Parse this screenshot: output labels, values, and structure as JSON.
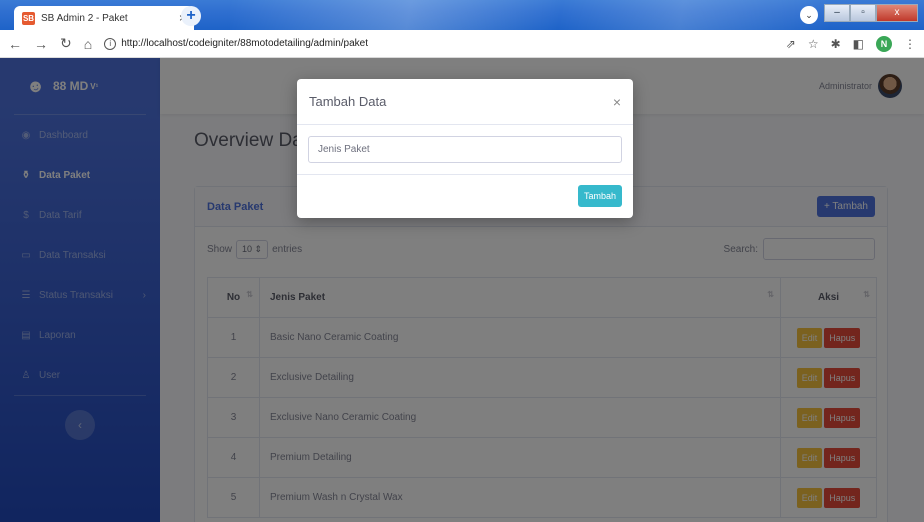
{
  "browser": {
    "tab_title": "SB Admin 2 - Paket",
    "tab_close": "×",
    "new_tab": "+",
    "url": "http://localhost/codeigniter/88motodetailing/admin/paket",
    "avatar_letter": "N",
    "window_controls": [
      "–",
      "▫",
      "x"
    ]
  },
  "sidebar": {
    "brand": "88 MD",
    "brand_sup": "V¹",
    "items": [
      {
        "label": "Dashboard",
        "icon": "tachometer-icon",
        "glyph": "◉"
      },
      {
        "label": "Data Paket",
        "icon": "bottle-icon",
        "glyph": "⚱"
      },
      {
        "label": "Data Tarif",
        "icon": "dollar-icon",
        "glyph": "$"
      },
      {
        "label": "Data Transaksi",
        "icon": "money-icon",
        "glyph": "▭"
      },
      {
        "label": "Status Transaksi",
        "icon": "list-icon",
        "glyph": "☰"
      },
      {
        "label": "Laporan",
        "icon": "file-icon",
        "glyph": "▤"
      },
      {
        "label": "User",
        "icon": "users-icon",
        "glyph": "♙"
      }
    ],
    "toggle": "‹"
  },
  "topbar": {
    "user_name": "Administrator"
  },
  "page": {
    "title": "Overview Data Paket"
  },
  "card": {
    "title": "Data Paket",
    "add_button": "+ Tambah",
    "show_label": "Show",
    "entries_value": "10",
    "entries_label": "entries",
    "search_label": "Search:",
    "columns": [
      "No",
      "Jenis Paket",
      "Aksi"
    ],
    "rows": [
      {
        "no": "1",
        "name": "Basic Nano Ceramic Coating"
      },
      {
        "no": "2",
        "name": "Exclusive Detailing"
      },
      {
        "no": "3",
        "name": "Exclusive Nano Ceramic Coating"
      },
      {
        "no": "4",
        "name": "Premium Detailing"
      },
      {
        "no": "5",
        "name": "Premium Wash n Crystal Wax"
      }
    ],
    "edit_label": "Edit",
    "delete_label": "Hapus"
  },
  "modal": {
    "title": "Tambah Data",
    "close": "×",
    "input_placeholder": "Jenis Paket",
    "save_button": "Tambah"
  }
}
